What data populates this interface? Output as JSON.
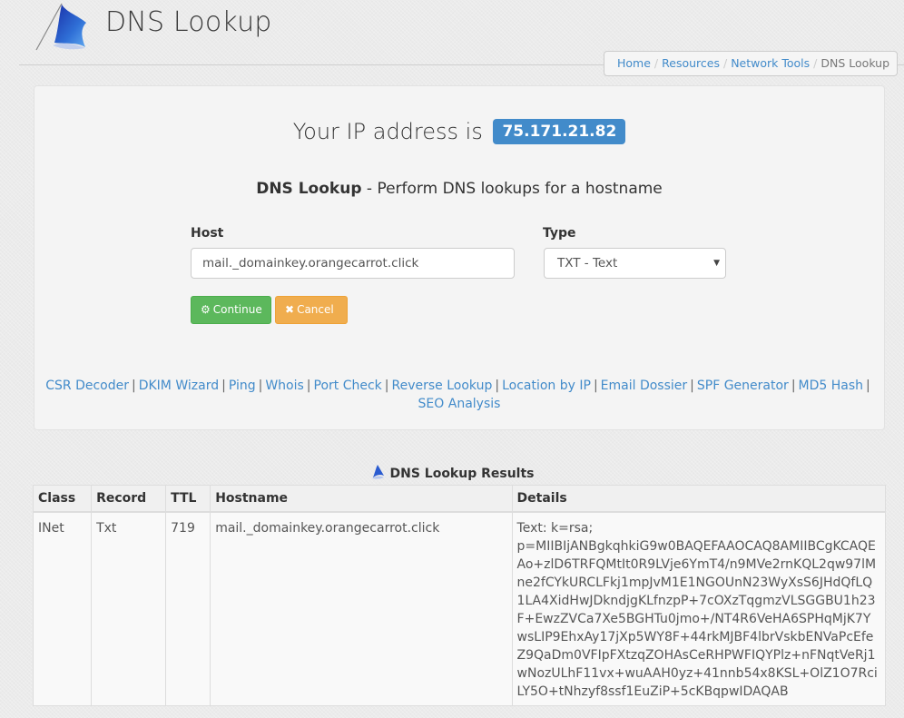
{
  "header": {
    "site_title": "DNS Lookup",
    "logo_icon": "blue-flag-icon"
  },
  "breadcrumb": {
    "items": [
      {
        "label": "Home",
        "link": true
      },
      {
        "label": "Resources",
        "link": true
      },
      {
        "label": "Network Tools",
        "link": true
      },
      {
        "label": "DNS Lookup",
        "link": false
      }
    ],
    "separator": "/"
  },
  "ip": {
    "prefix": "Your IP address is",
    "address": "75.171.21.82"
  },
  "tool": {
    "name": "DNS Lookup",
    "description": " - Perform DNS lookups for a hostname"
  },
  "form": {
    "host_label": "Host",
    "host_value": "mail._domainkey.orangecarrot.click",
    "type_label": "Type",
    "type_value": "TXT - Text",
    "continue_label": "Continue",
    "continue_icon": "gear-icon",
    "cancel_label": "Cancel",
    "cancel_icon": "close-icon",
    "continue_color": "#5cb85c",
    "cancel_color": "#f0ad4e"
  },
  "tools_links": [
    "CSR Decoder",
    "DKIM Wizard",
    "Ping",
    "Whois",
    "Port Check",
    "Reverse Lookup",
    "Location by IP",
    "Email Dossier",
    "SPF Generator",
    "MD5 Hash",
    "SEO Analysis"
  ],
  "results": {
    "title": "DNS Lookup Results",
    "columns": [
      "Class",
      "Record",
      "TTL",
      "Hostname",
      "Details"
    ],
    "rows": [
      {
        "class": "INet",
        "record": "Txt",
        "ttl": "719",
        "hostname": "mail._domainkey.orangecarrot.click",
        "details_line1": "Text: k=rsa;",
        "details_line2": "p=MIIBIjANBgkqhkiG9w0BAQEFAAOCAQ8AMIIBCgKCAQEAo+zlD6TRFQMtIt0R9LVje6YmT4/n9MVe2rnKQL2qw97lMne2fCYkURCLFkj1mpJvM1E1NGOUnN23WyXsS6JHdQfLQ1LA4XidHwJDkndjgKLfnzpP+7cOXzTqgmzVLSGGBU1h23F+EwzZVCa7Xe5BGHTu0jmo+/NT4R6VeHA6SPHqMjK7YwsLIP9EhxAy17jXp5WY8F+44rkMJBF4lbrVskbENVaPcEfeZ9QaDm0VFIpFXtzqZOHAsCeRHPWFIQYPlz+nFNqtVeRj1wNozULhF11vx+wuAAH0yz+41nnb54x8KSL+OlZ1O7RciLY5O+tNhzyf8ssf1EuZiP+5cKBqpwIDAQAB"
      }
    ]
  },
  "colors": {
    "link": "#428bca",
    "badge": "#428bca"
  }
}
